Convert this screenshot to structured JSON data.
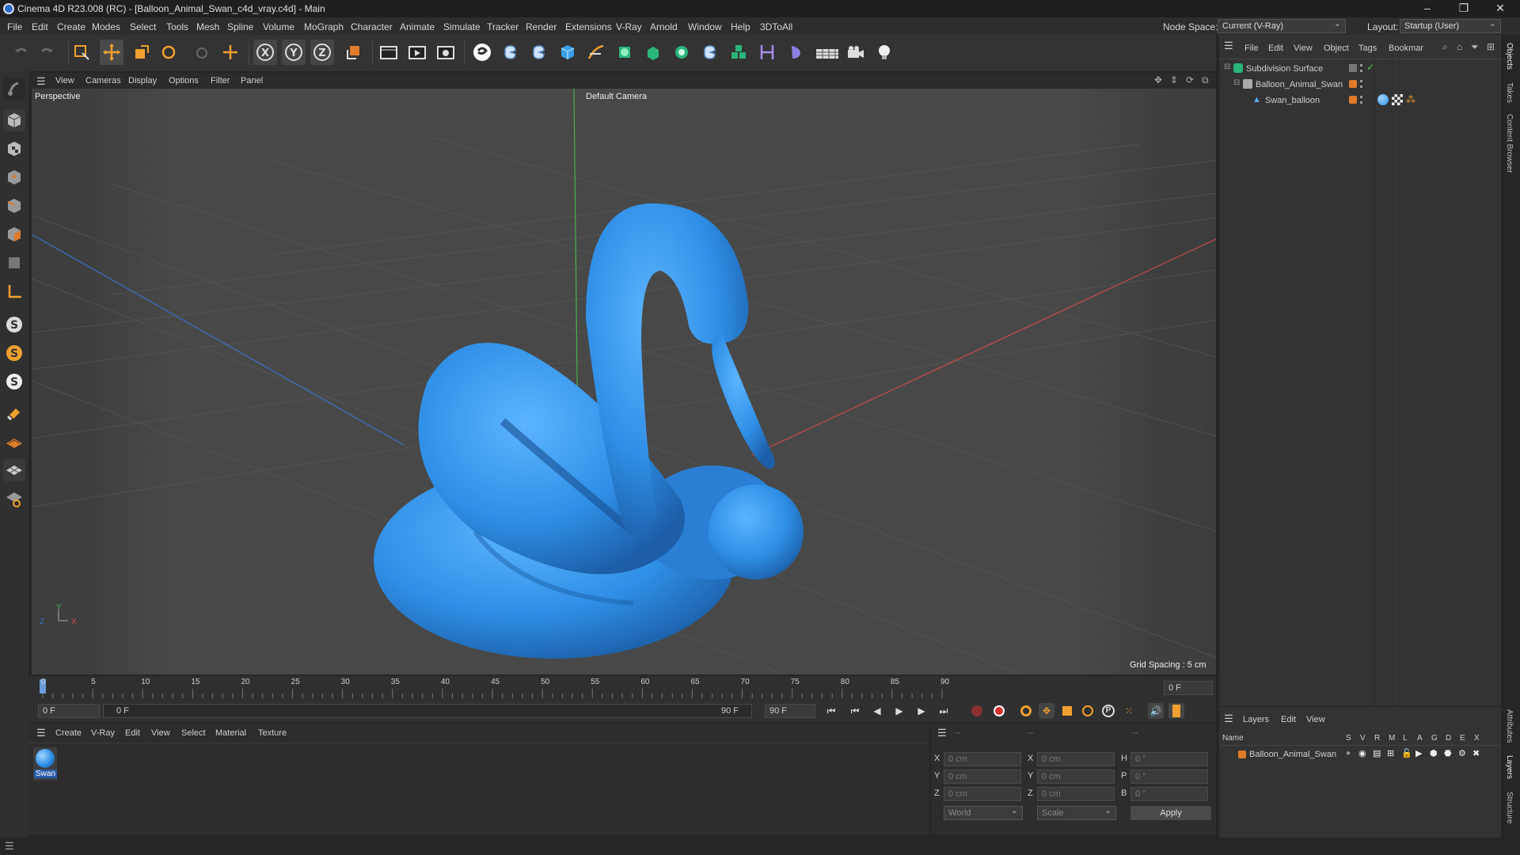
{
  "window": {
    "title": "Cinema 4D R23.008 (RC) - [Balloon_Animal_Swan_c4d_vray.c4d] - Main",
    "min": "–",
    "restore": "❐",
    "close": "✕"
  },
  "menu": [
    "File",
    "Edit",
    "Create",
    "Modes",
    "Select",
    "Tools",
    "Mesh",
    "Spline",
    "Volume",
    "MoGraph",
    "Character",
    "Animate",
    "Simulate",
    "Tracker",
    "Render",
    "Extensions",
    "V-Ray",
    "Arnold",
    "Window",
    "Help",
    "3DToAll"
  ],
  "nodespace": {
    "label": "Node Space:",
    "value": "Current (V-Ray)"
  },
  "layout": {
    "label": "Layout:",
    "value": "Startup (User)"
  },
  "viewport_menu": [
    "View",
    "Cameras",
    "Display",
    "Options",
    "Filter",
    "Panel"
  ],
  "viewport": {
    "name": "Perspective",
    "camera": "Default Camera",
    "grid_spacing": "Grid Spacing : 5 cm",
    "axis": {
      "y": "Y",
      "z": "Z",
      "x": "X"
    }
  },
  "object_menu": [
    "File",
    "Edit",
    "View",
    "Object",
    "Tags",
    "Bookmar"
  ],
  "objects": [
    {
      "name": "Subdivision Surface"
    },
    {
      "name": "Balloon_Animal_Swan"
    },
    {
      "name": "Swan_balloon"
    }
  ],
  "timeline": {
    "ticks": [
      "0",
      "5",
      "10",
      "15",
      "20",
      "25",
      "30",
      "35",
      "40",
      "45",
      "50",
      "55",
      "60",
      "65",
      "70",
      "75",
      "80",
      "85",
      "90"
    ],
    "current": "0 F"
  },
  "transport": {
    "start": "0 F",
    "range_start": "0 F",
    "range_end": "90 F",
    "end": "90 F"
  },
  "material_menu": [
    "Create",
    "V-Ray",
    "Edit",
    "View",
    "Select",
    "Material",
    "Texture"
  ],
  "material": {
    "name": "Swan",
    "color": "#2f8fe6"
  },
  "coords": {
    "header": [
      "--",
      "--",
      "--"
    ],
    "rows": [
      {
        "a": "X",
        "av": "0 cm",
        "b": "X",
        "bv": "0 cm",
        "c": "H",
        "cv": "0 °"
      },
      {
        "a": "Y",
        "av": "0 cm",
        "b": "Y",
        "bv": "0 cm",
        "c": "P",
        "cv": "0 °"
      },
      {
        "a": "Z",
        "av": "0 cm",
        "b": "Z",
        "bv": "0 cm",
        "c": "B",
        "cv": "0 °"
      }
    ],
    "world": "World",
    "scale": "Scale",
    "apply": "Apply"
  },
  "layers_menu": [
    "Layers",
    "Edit",
    "View"
  ],
  "layers": {
    "columns": [
      "Name",
      "S",
      "V",
      "R",
      "M",
      "L",
      "A",
      "G",
      "D",
      "E",
      "X"
    ],
    "rows": [
      {
        "name": "Balloon_Animal_Swan"
      }
    ]
  },
  "side_tabs": [
    "Objects",
    "Takes",
    "Content Browser",
    "Attributes",
    "Layers",
    "Structure"
  ],
  "colors": {
    "balloon": "#2f8fe6",
    "accent": "#e07b2a",
    "bg": "#4c4c4c"
  }
}
